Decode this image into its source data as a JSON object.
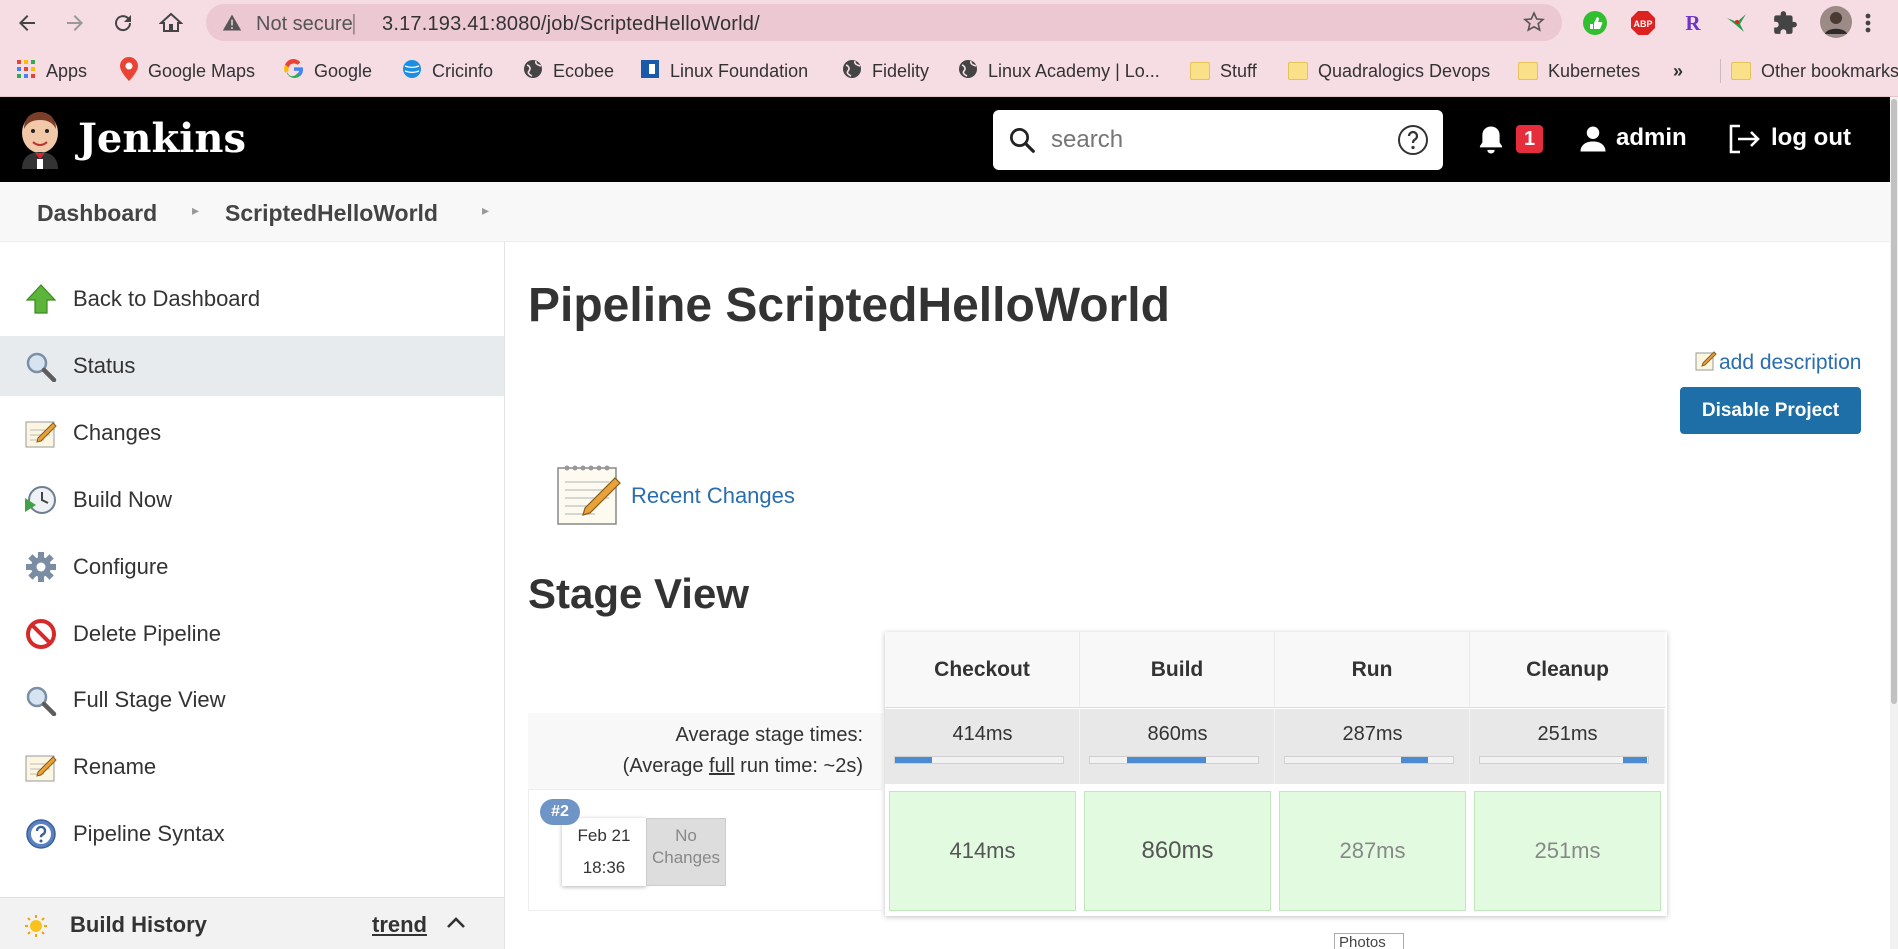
{
  "browser": {
    "security_label": "Not secure",
    "url": "3.17.193.41:8080/job/ScriptedHelloWorld/",
    "bookmarks": [
      {
        "label": "Apps"
      },
      {
        "label": "Google Maps"
      },
      {
        "label": "Google"
      },
      {
        "label": "Cricinfo"
      },
      {
        "label": "Ecobee"
      },
      {
        "label": "Linux Foundation"
      },
      {
        "label": "Fidelity"
      },
      {
        "label": "Linux Academy | Lo..."
      },
      {
        "label": "Stuff"
      },
      {
        "label": "Quadralogics Devops"
      },
      {
        "label": "Kubernetes"
      },
      {
        "label": "»"
      },
      {
        "label": "Other bookmarks"
      }
    ],
    "extensions": {
      "abp": "ABP",
      "r": "R"
    }
  },
  "header": {
    "app_name": "Jenkins",
    "search_placeholder": "search",
    "notification_count": "1",
    "user": "admin",
    "logout": "log out"
  },
  "breadcrumb": [
    "Dashboard",
    "ScriptedHelloWorld"
  ],
  "sidebar": {
    "items": [
      {
        "label": "Back to Dashboard",
        "icon": "up-arrow-icon"
      },
      {
        "label": "Status",
        "icon": "magnifier-icon"
      },
      {
        "label": "Changes",
        "icon": "notepad-icon"
      },
      {
        "label": "Build Now",
        "icon": "clock-play-icon"
      },
      {
        "label": "Configure",
        "icon": "gear-icon"
      },
      {
        "label": "Delete Pipeline",
        "icon": "no-entry-icon"
      },
      {
        "label": "Full Stage View",
        "icon": "magnifier-icon"
      },
      {
        "label": "Rename",
        "icon": "notepad-icon"
      },
      {
        "label": "Pipeline Syntax",
        "icon": "help-icon"
      }
    ],
    "build_history": {
      "title": "Build History",
      "trend": "trend"
    }
  },
  "main": {
    "title": "Pipeline ScriptedHelloWorld",
    "add_description": "add description",
    "disable_button": "Disable Project",
    "recent_changes": "Recent Changes",
    "stage_view_title": "Stage View",
    "avg_stage_label": "Average stage times:",
    "avg_run_prefix": "(Average ",
    "avg_run_full": "full",
    "avg_run_suffix": " run time: ~2s)",
    "stages": [
      {
        "name": "Checkout",
        "avg": "414ms",
        "run": "414ms",
        "avg_fraction": 0.22
      },
      {
        "name": "Build",
        "avg": "860ms",
        "run": "860ms",
        "avg_fraction": 0.47
      },
      {
        "name": "Run",
        "avg": "287ms",
        "run": "287ms",
        "avg_fraction": 0.16
      },
      {
        "name": "Cleanup",
        "avg": "251ms",
        "run": "251ms",
        "avg_fraction": 0.14
      }
    ],
    "run": {
      "number": "#2",
      "date": "Feb 21",
      "time": "18:36",
      "changes_line1": "No",
      "changes_line2": "Changes"
    },
    "tooltip": "Photos"
  },
  "colors": {
    "header_bg": "#000000",
    "link": "#2a6db0",
    "button": "#1e6ea7",
    "stage_success": "#e2fbe0",
    "badge": "#e52d3b"
  }
}
